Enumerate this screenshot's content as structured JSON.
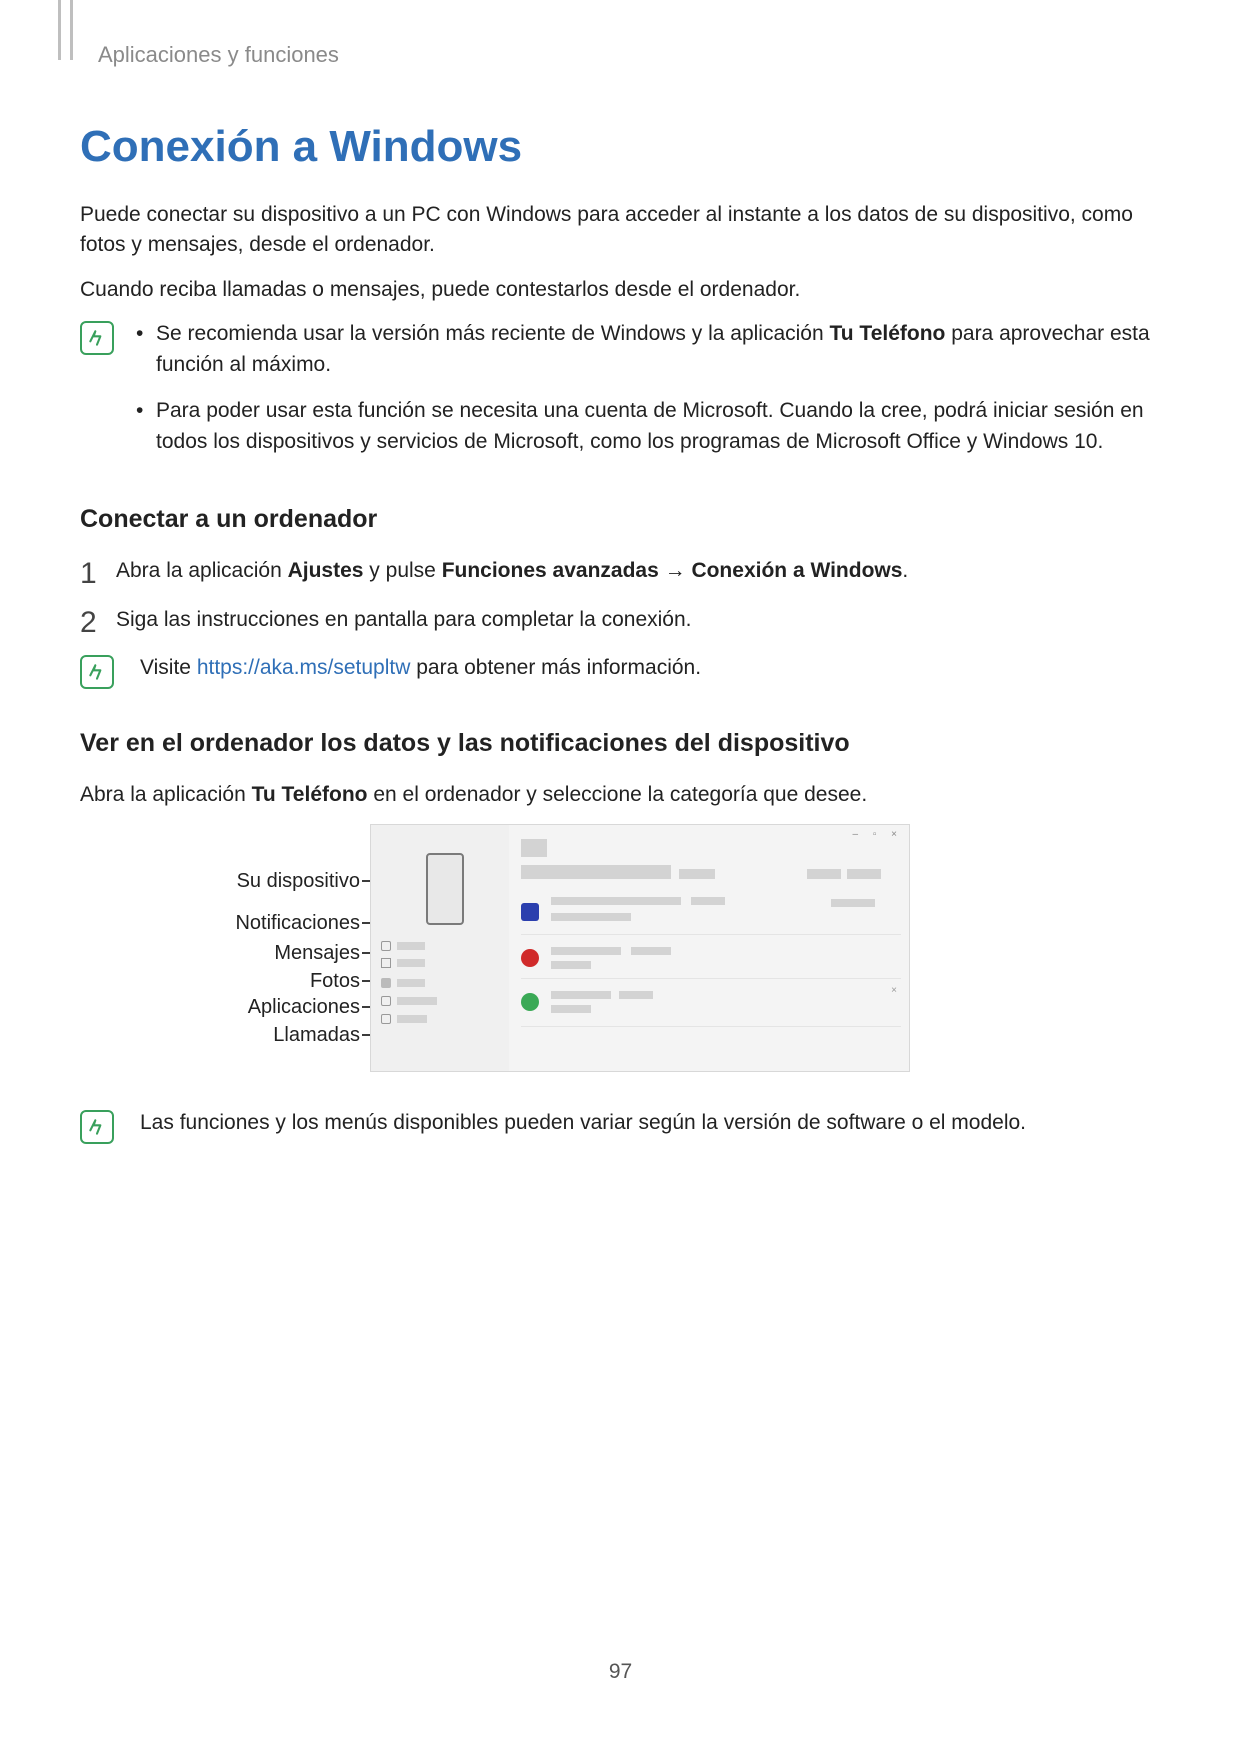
{
  "breadcrumb": "Aplicaciones y funciones",
  "title": "Conexión a Windows",
  "intro1": "Puede conectar su dispositivo a un PC con Windows para acceder al instante a los datos de su dispositivo, como fotos y mensajes, desde el ordenador.",
  "intro2": "Cuando reciba llamadas o mensajes, puede contestarlos desde el ordenador.",
  "note1": {
    "li1a": "Se recomienda usar la versión más reciente de Windows y la aplicación ",
    "li1_bold": "Tu Teléfono",
    "li1b": " para aprovechar esta función al máximo.",
    "li2": "Para poder usar esta función se necesita una cuenta de Microsoft. Cuando la cree, podrá iniciar sesión en todos los dispositivos y servicios de Microsoft, como los programas de Microsoft Office y Windows 10."
  },
  "sub1": "Conectar a un ordenador",
  "step1": {
    "a": "Abra la aplicación ",
    "b1": "Ajustes",
    "c": " y pulse ",
    "b2": "Funciones avanzadas",
    "arrow": " → ",
    "b3": "Conexión a Windows",
    "d": "."
  },
  "step2": "Siga las instrucciones en pantalla para completar la conexión.",
  "note2": {
    "a": "Visite ",
    "link_text": "https://aka.ms/setupltw",
    "link_href": "https://aka.ms/setupltw",
    "b": " para obtener más información."
  },
  "sub2": "Ver en el ordenador los datos y las notificaciones del dispositivo",
  "p2a": "Abra la aplicación ",
  "p2b": "Tu Teléfono",
  "p2c": " en el ordenador y seleccione la categoría que desee.",
  "labels": {
    "device": "Su dispositivo",
    "notifications": "Notificaciones",
    "messages": "Mensajes",
    "photos": "Fotos",
    "apps": "Aplicaciones",
    "calls": "Llamadas"
  },
  "note3": "Las funciones y los menús disponibles pueden variar según la versión de software o el modelo.",
  "page_number": "97",
  "win_controls": "–  ▫  ×"
}
